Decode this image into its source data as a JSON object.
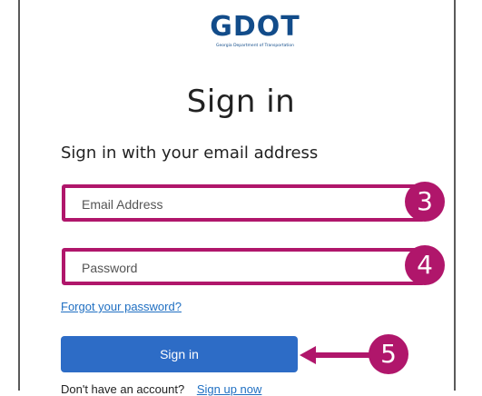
{
  "logo": {
    "text": "GDOT",
    "subtext": "Georgia Department of Transportation"
  },
  "page": {
    "title": "Sign in",
    "subtitle": "Sign in with your email address"
  },
  "email": {
    "placeholder": "Email Address",
    "value": ""
  },
  "password": {
    "placeholder": "Password",
    "value": ""
  },
  "callouts": {
    "email_step": "3",
    "password_step": "4",
    "signin_step": "5"
  },
  "links": {
    "forgot_password": "Forgot your password?"
  },
  "signin_button": {
    "label": "Sign in"
  },
  "signup": {
    "prompt": "Don't have an account?",
    "link": "Sign up now"
  },
  "colors": {
    "highlight": "#b0166b",
    "button": "#2d6cc6",
    "link": "#1f6fc2",
    "brand": "#124c8a"
  }
}
